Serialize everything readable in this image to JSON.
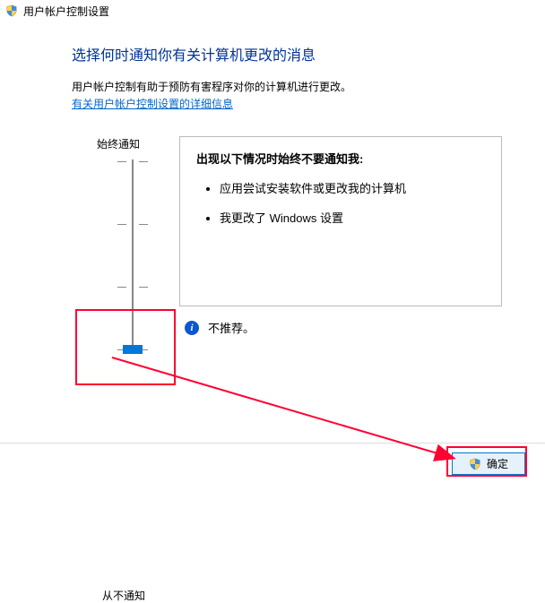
{
  "window": {
    "title": "用户帐户控制设置"
  },
  "header": {
    "title": "选择何时通知你有关计算机更改的消息",
    "description": "用户帐户控制有助于预防有害程序对你的计算机进行更改。",
    "link": "有关用户帐户控制设置的详细信息"
  },
  "slider": {
    "top_label": "始终通知",
    "bottom_label": "从不通知",
    "level_count": 4,
    "current_level": 3
  },
  "message": {
    "heading": "出现以下情况时始终不要通知我:",
    "bullets": [
      "应用尝试安装软件或更改我的计算机",
      "我更改了 Windows 设置"
    ],
    "note": "不推荐。"
  },
  "buttons": {
    "ok": "确定"
  }
}
